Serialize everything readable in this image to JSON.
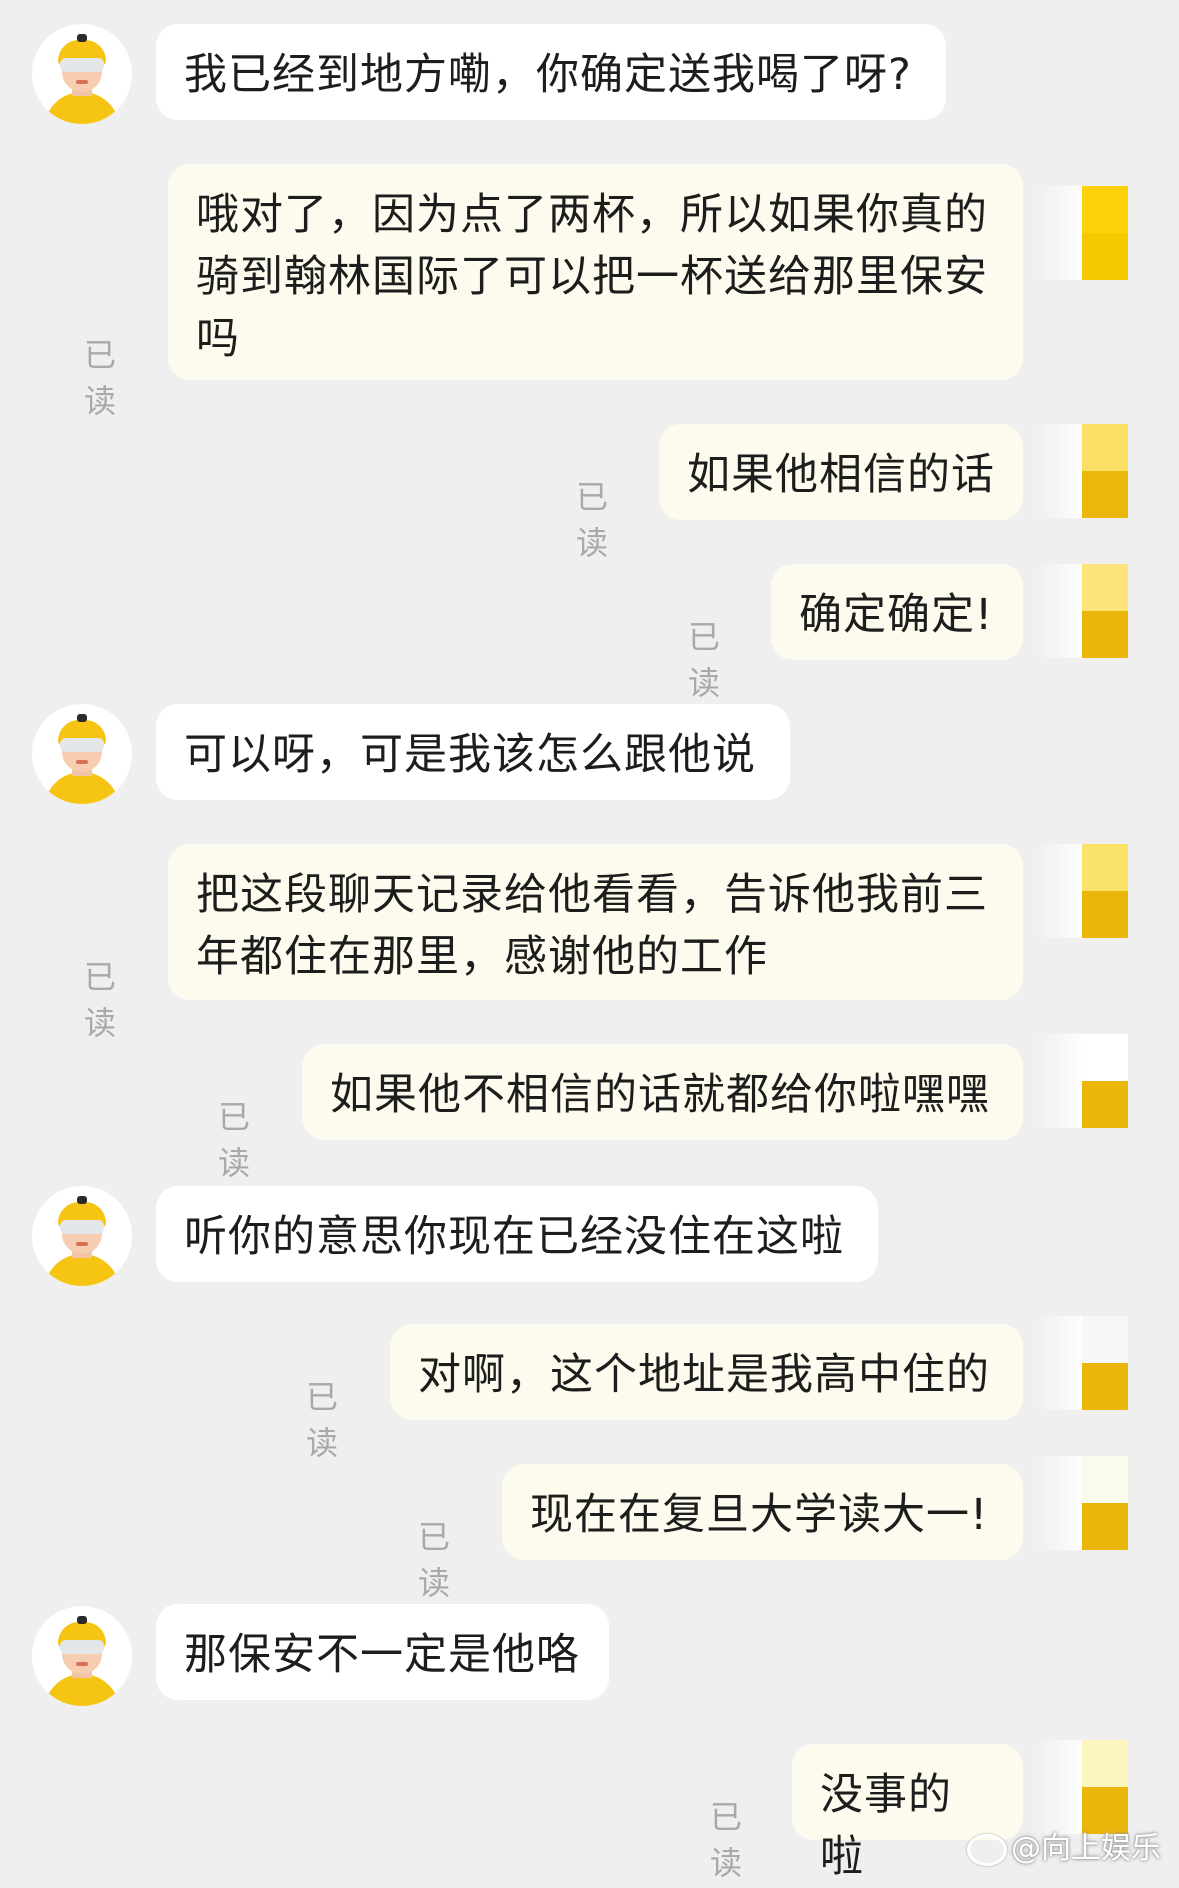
{
  "read_label": "已读",
  "messages": [
    {
      "side": "in",
      "text": "我已经到地方嘞，你确定送我喝了呀?"
    },
    {
      "side": "out",
      "text": "哦对了，因为点了两杯，所以如果你真的骑到翰林国际了可以把一杯送给那里保安吗"
    },
    {
      "side": "out",
      "text": "如果他相信的话"
    },
    {
      "side": "out",
      "text": "确定确定!"
    },
    {
      "side": "in",
      "text": "可以呀，可是我该怎么跟他说"
    },
    {
      "side": "out",
      "text": "把这段聊天记录给他看看，告诉他我前三年都住在那里，感谢他的工作"
    },
    {
      "side": "out",
      "text": "如果他不相信的话就都给你啦嘿嘿"
    },
    {
      "side": "in",
      "text": "听你的意思你现在已经没住在这啦"
    },
    {
      "side": "out",
      "text": "对啊，这个地址是我高中住的"
    },
    {
      "side": "out",
      "text": "现在在复旦大学读大一!"
    },
    {
      "side": "in",
      "text": "那保安不一定是他咯"
    },
    {
      "side": "out",
      "text": "没事的啦"
    }
  ],
  "cover_colors": [
    [
      "#fdd20a",
      "#f5c800"
    ],
    [
      "#fbe066",
      "#eab70a"
    ],
    [
      "#fde37a",
      "#ebb50c"
    ],
    [
      "#fbe36a",
      "#ebb60c"
    ],
    [
      "#ffffff",
      "#ebb60c"
    ],
    [
      "#f7f7f7",
      "#ebb60c"
    ],
    [
      "#fbfbec",
      "#ebb60c"
    ],
    [
      "#fcf6be",
      "#ebb60c"
    ]
  ],
  "watermark": "@向上娱乐"
}
